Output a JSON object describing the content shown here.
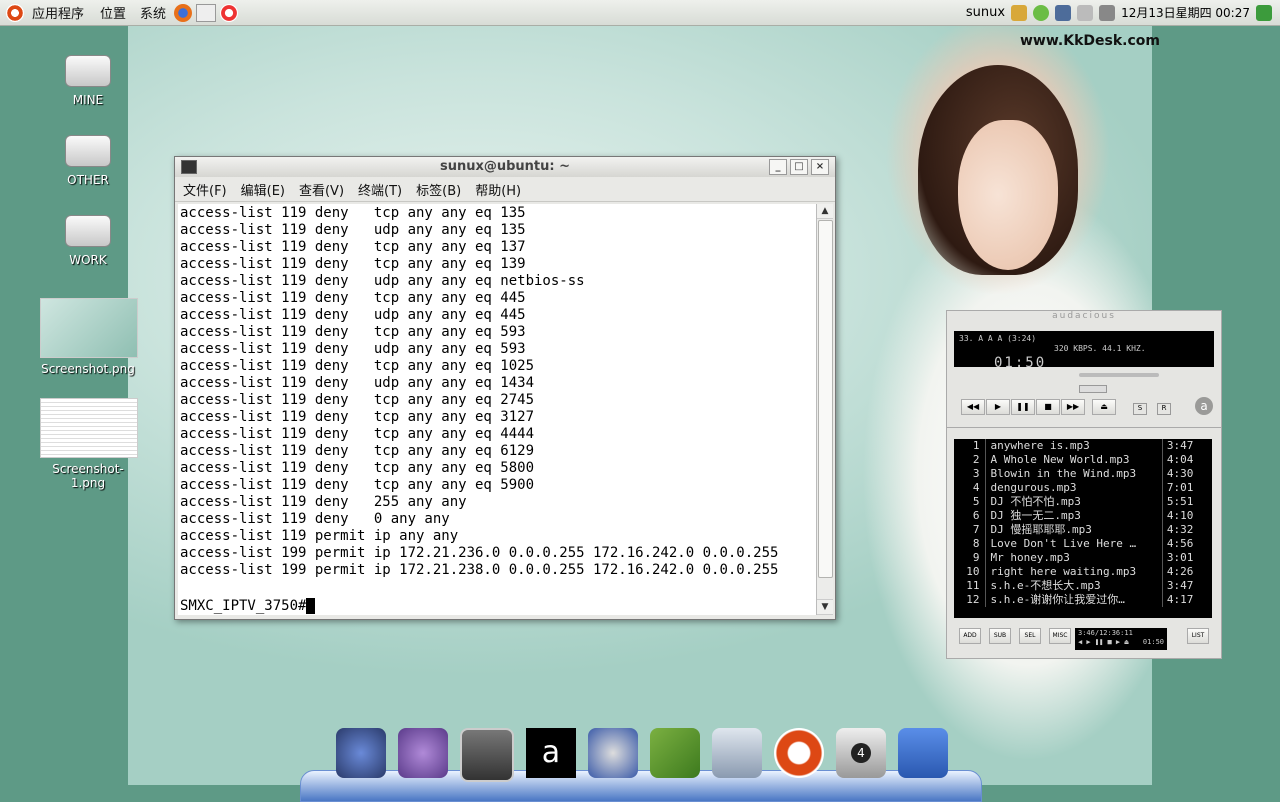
{
  "top_panel": {
    "applications": "应用程序",
    "places": "位置",
    "system": "系统",
    "user": "sunux",
    "clock": "12月13日星期四 00:27"
  },
  "watermark": "www.KkDesk.com",
  "desktop_icons": [
    {
      "label": "MINE",
      "icon": "drive-icon"
    },
    {
      "label": "OTHER",
      "icon": "drive-icon"
    },
    {
      "label": "WORK",
      "icon": "drive-icon"
    },
    {
      "label": "Screenshot.png",
      "icon": "image-thumbnail"
    },
    {
      "label": "Screenshot-1.png",
      "icon": "image-thumbnail"
    }
  ],
  "terminal": {
    "title": "sunux@ubuntu: ~",
    "menu": [
      "文件(F)",
      "编辑(E)",
      "查看(V)",
      "终端(T)",
      "标签(B)",
      "帮助(H)"
    ],
    "lines": [
      "access-list 119 deny   tcp any any eq 135",
      "access-list 119 deny   udp any any eq 135",
      "access-list 119 deny   tcp any any eq 137",
      "access-list 119 deny   tcp any any eq 139",
      "access-list 119 deny   udp any any eq netbios-ss",
      "access-list 119 deny   tcp any any eq 445",
      "access-list 119 deny   udp any any eq 445",
      "access-list 119 deny   tcp any any eq 593",
      "access-list 119 deny   udp any any eq 593",
      "access-list 119 deny   tcp any any eq 1025",
      "access-list 119 deny   udp any any eq 1434",
      "access-list 119 deny   tcp any any eq 2745",
      "access-list 119 deny   tcp any any eq 3127",
      "access-list 119 deny   tcp any any eq 4444",
      "access-list 119 deny   tcp any any eq 6129",
      "access-list 119 deny   tcp any any eq 5800",
      "access-list 119 deny   tcp any any eq 5900",
      "access-list 119 deny   255 any any",
      "access-list 119 deny   0 any any",
      "access-list 119 permit ip any any",
      "access-list 199 permit ip 172.21.236.0 0.0.0.255 172.16.242.0 0.0.0.255",
      "access-list 199 permit ip 172.21.238.0 0.0.0.255 172.16.242.0 0.0.0.255",
      ""
    ],
    "prompt": "SMXC_IPTV_3750#"
  },
  "audacious": {
    "track_info": "33. A  A      A  (3:24)",
    "bitrate": "320 KBPS. 44.1 KHZ.",
    "time": "01:50",
    "playlist": [
      {
        "n": "1",
        "name": "anywhere is.mp3",
        "dur": "3:47"
      },
      {
        "n": "2",
        "name": "A Whole New World.mp3",
        "dur": "4:04"
      },
      {
        "n": "3",
        "name": "Blowin in the Wind.mp3",
        "dur": "4:30"
      },
      {
        "n": "4",
        "name": "dengurous.mp3",
        "dur": "7:01"
      },
      {
        "n": "5",
        "name": "DJ 不怕不怕.mp3",
        "dur": "5:51"
      },
      {
        "n": "6",
        "name": "DJ 独一无二.mp3",
        "dur": "4:10"
      },
      {
        "n": "7",
        "name": "DJ 慢摇耶耶耶.mp3",
        "dur": "4:32"
      },
      {
        "n": "8",
        "name": "Love Don't Live Here …",
        "dur": "4:56"
      },
      {
        "n": "9",
        "name": "Mr honey.mp3",
        "dur": "3:01"
      },
      {
        "n": "10",
        "name": "right here waiting.mp3",
        "dur": "4:26"
      },
      {
        "n": "11",
        "name": "s.h.e-不想长大.mp3",
        "dur": "3:47"
      },
      {
        "n": "12",
        "name": "s.h.e-谢谢你让我爱过你…",
        "dur": "4:17"
      }
    ],
    "pl_buttons": [
      "ADD",
      "SUB",
      "SEL",
      "MISC"
    ],
    "list_button": "LIST",
    "pl_total": "3:46/12:36:11",
    "pl_time": "01:50"
  },
  "dock": [
    "gnome-do-icon",
    "pidgin-icon",
    "terminal-icon",
    "audacious-icon",
    "media-player-icon",
    "books-icon",
    "computer-icon",
    "ubuntu-icon",
    "workspace-switcher-icon",
    "trash-icon"
  ],
  "dock_badge": "4"
}
